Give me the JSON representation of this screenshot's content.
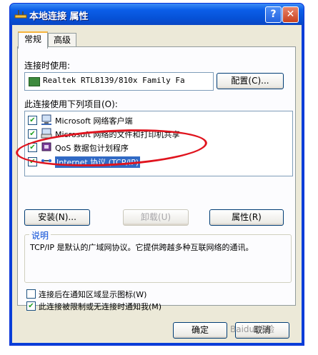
{
  "window": {
    "title": "本地连接 属性",
    "help_label": "?",
    "close_label": "✕"
  },
  "tabs": [
    {
      "label": "常规",
      "active": true
    },
    {
      "label": "高级",
      "active": false
    }
  ],
  "connection": {
    "label": "连接时使用:",
    "device": "Realtek RTL8139/810x Family Fa",
    "configure_label": "配置(C)..."
  },
  "components": {
    "label": "此连接使用下列项目(O):",
    "items": [
      {
        "label": "Microsoft 网络客户端",
        "checked": true,
        "icon": "network-client-icon"
      },
      {
        "label": "Microsoft 网络的文件和打印机共享",
        "checked": true,
        "icon": "printer-share-icon"
      },
      {
        "label": "QoS 数据包计划程序",
        "checked": true,
        "icon": "qos-icon"
      },
      {
        "label": "Internet 协议 (TCP/IP)",
        "checked": true,
        "icon": "protocol-icon"
      }
    ],
    "install_label": "安装(N)...",
    "uninstall_label": "卸载(U)",
    "properties_label": "属性(R)"
  },
  "description": {
    "title": "说明",
    "text": "TCP/IP 是默认的广域网协议。它提供跨越多种互联网络的通讯。"
  },
  "options": {
    "show_icon_label": "连接后在通知区域显示图标(W)",
    "show_icon_checked": false,
    "notify_label": "此连接被限制或无连接时通知我(M)",
    "notify_checked": true
  },
  "footer": {
    "ok_label": "确定",
    "cancel_label": "取消"
  },
  "watermark": "Baidu 经验",
  "colors": {
    "title_blue": "#0a46c4",
    "face": "#ece9d8",
    "highlight_ring": "#e0141e"
  }
}
